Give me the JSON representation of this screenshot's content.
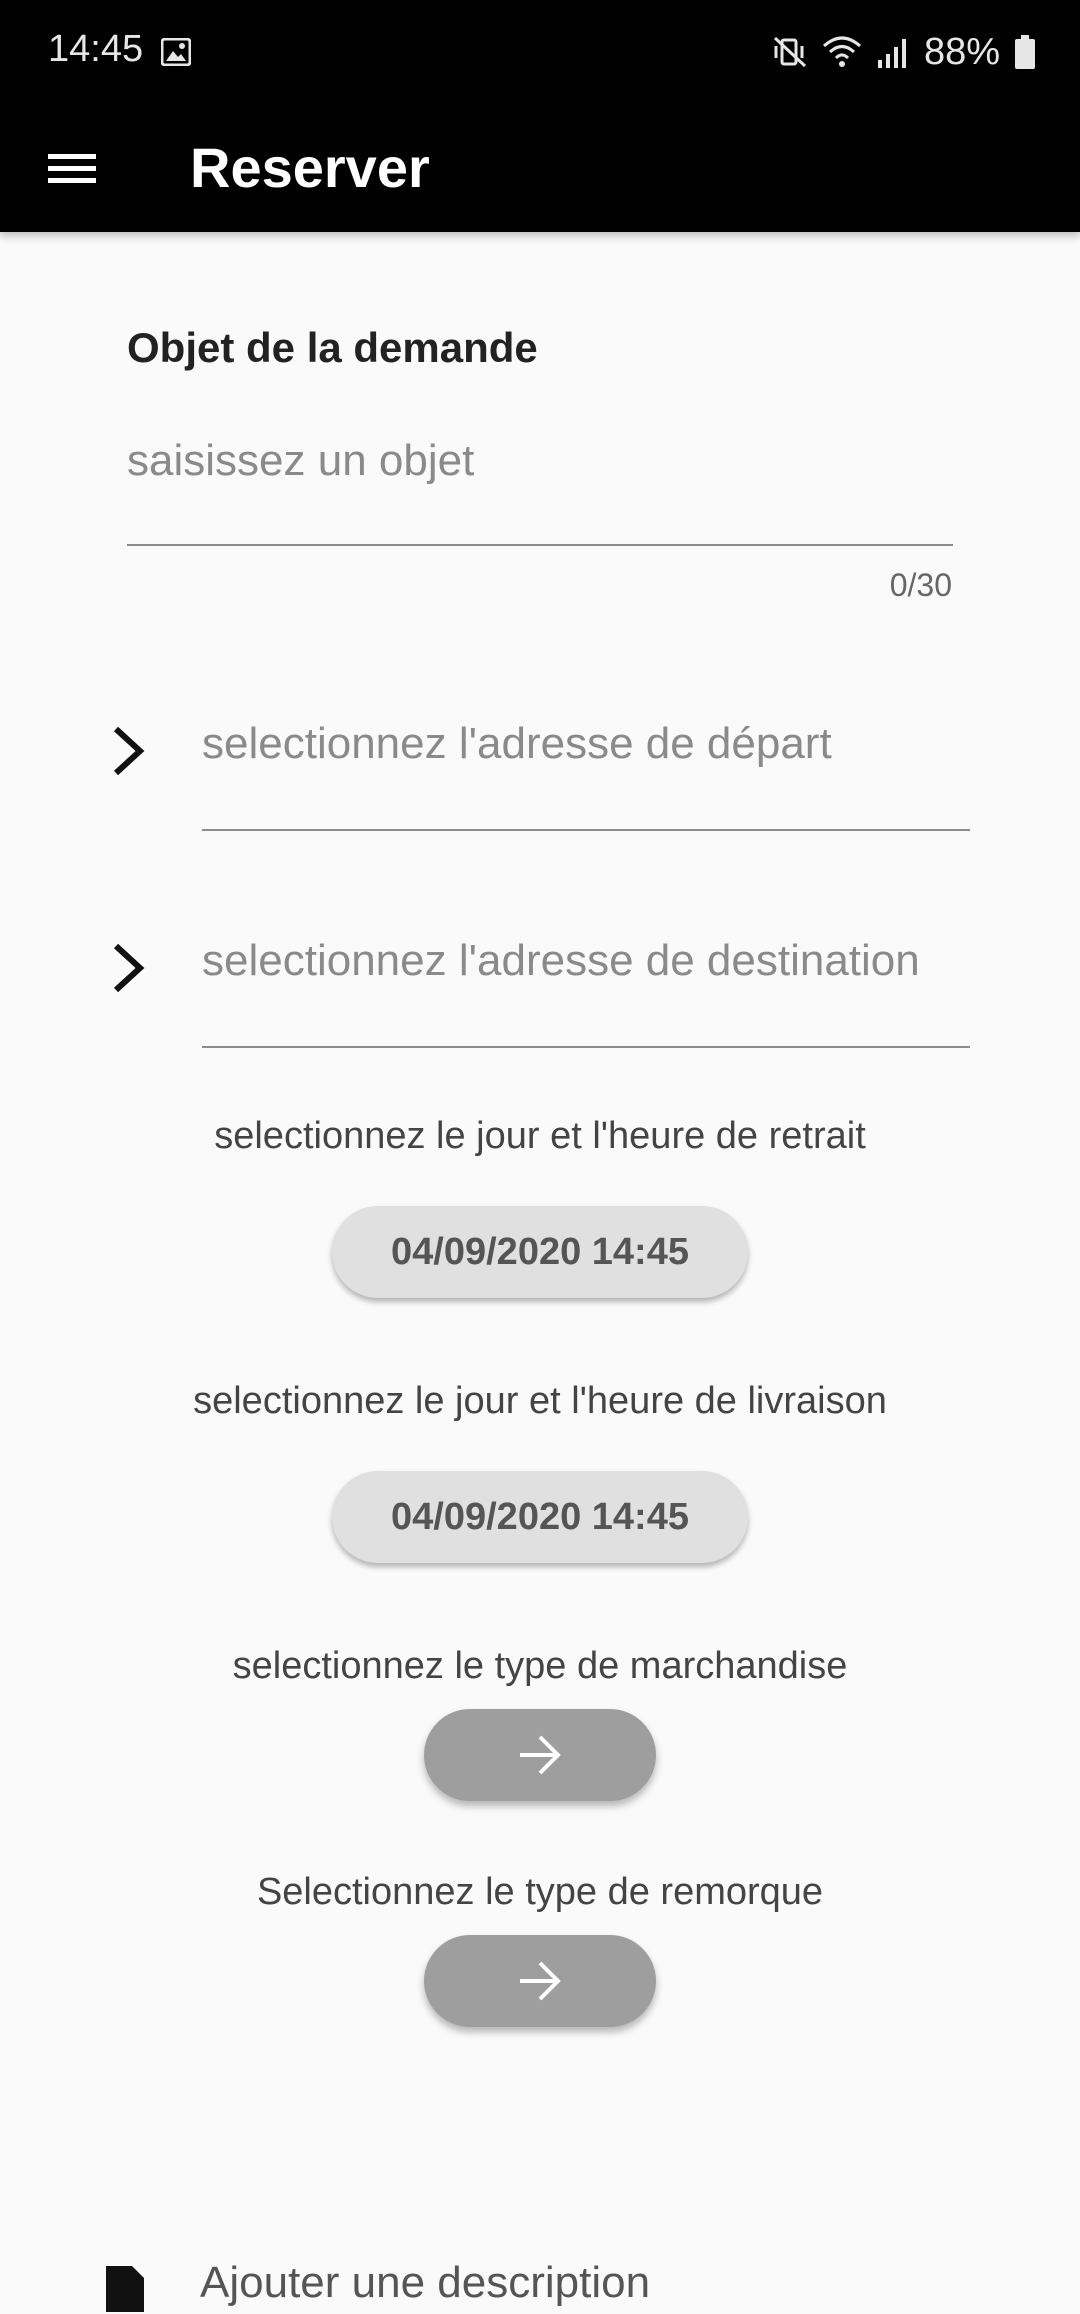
{
  "status_bar": {
    "time": "14:45",
    "battery": "88%",
    "icons": [
      "image-icon",
      "mute-vibrate-icon",
      "wifi-icon",
      "signal-icon",
      "battery-icon"
    ]
  },
  "app_bar": {
    "title": "Reserver",
    "menu_icon": "menu-icon"
  },
  "form": {
    "object_label": "Objet de la demande",
    "object_value": "",
    "object_placeholder": "saisissez un objet",
    "object_counter": "0/30",
    "departure_placeholder": "selectionnez l'adresse de départ",
    "destination_placeholder": "selectionnez l'adresse de destination",
    "pickup_label": "selectionnez le jour et l'heure de retrait",
    "pickup_datetime": "04/09/2020 14:45",
    "delivery_label": "selectionnez le jour et l'heure de livraison",
    "delivery_datetime": "04/09/2020 14:45",
    "merchandise_label": "selectionnez le type de marchandise",
    "trailer_label": "Selectionnez le type de remorque",
    "bottom_item_text": "Ajouter une description"
  },
  "colors": {
    "app_bar": "#000000",
    "background": "#fafafa",
    "date_button": "#e0e0e0",
    "arrow_button": "#9e9e9e"
  }
}
